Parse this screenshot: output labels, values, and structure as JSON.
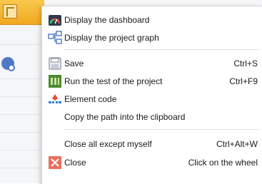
{
  "menu": {
    "items": [
      {
        "label": "Display the dashboard",
        "icon": "speedometer-icon",
        "shortcut": ""
      },
      {
        "label": "Display the project graph",
        "icon": "project-graph-icon",
        "shortcut": ""
      },
      {
        "label": "Save",
        "icon": "save-icon",
        "shortcut": "Ctrl+S"
      },
      {
        "label": "Run the test of the project",
        "icon": "run-test-icon",
        "shortcut": "Ctrl+F9"
      },
      {
        "label": "Element code",
        "icon": "element-code-icon",
        "shortcut": ""
      },
      {
        "label": "Copy the path into the clipboard",
        "icon": "",
        "shortcut": ""
      },
      {
        "label": "Close all except myself",
        "icon": "",
        "shortcut": "Ctrl+Alt+W"
      },
      {
        "label": "Close",
        "icon": "close-icon",
        "shortcut": "Click on the wheel"
      }
    ]
  },
  "colors": {
    "accent_orange": "#f0a820",
    "close_red": "#e8705f",
    "run_green": "#4d8a2a",
    "graph_blue": "#3d6fc0"
  }
}
